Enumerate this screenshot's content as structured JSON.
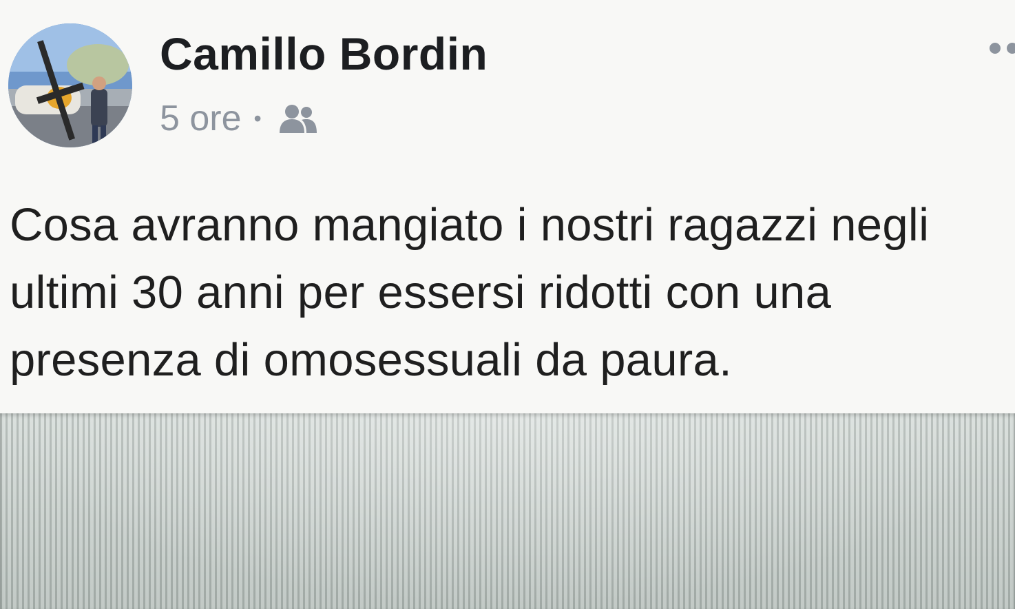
{
  "post": {
    "author": "Camillo Bordin",
    "time": "5 ore",
    "separator": "•",
    "audience_icon": "friends-icon",
    "more_icon": "more-options-icon",
    "text_lines": [
      "Cosa avranno mangiato i nostri ragazzi negli",
      "ultimi 30 anni per essersi ridotti con una",
      "presenza di omosessuali da paura."
    ]
  },
  "colors": {
    "background": "#f8f8f6",
    "name": "#1c1e21",
    "meta": "#8d949e",
    "body_text": "#1f1f1f"
  }
}
